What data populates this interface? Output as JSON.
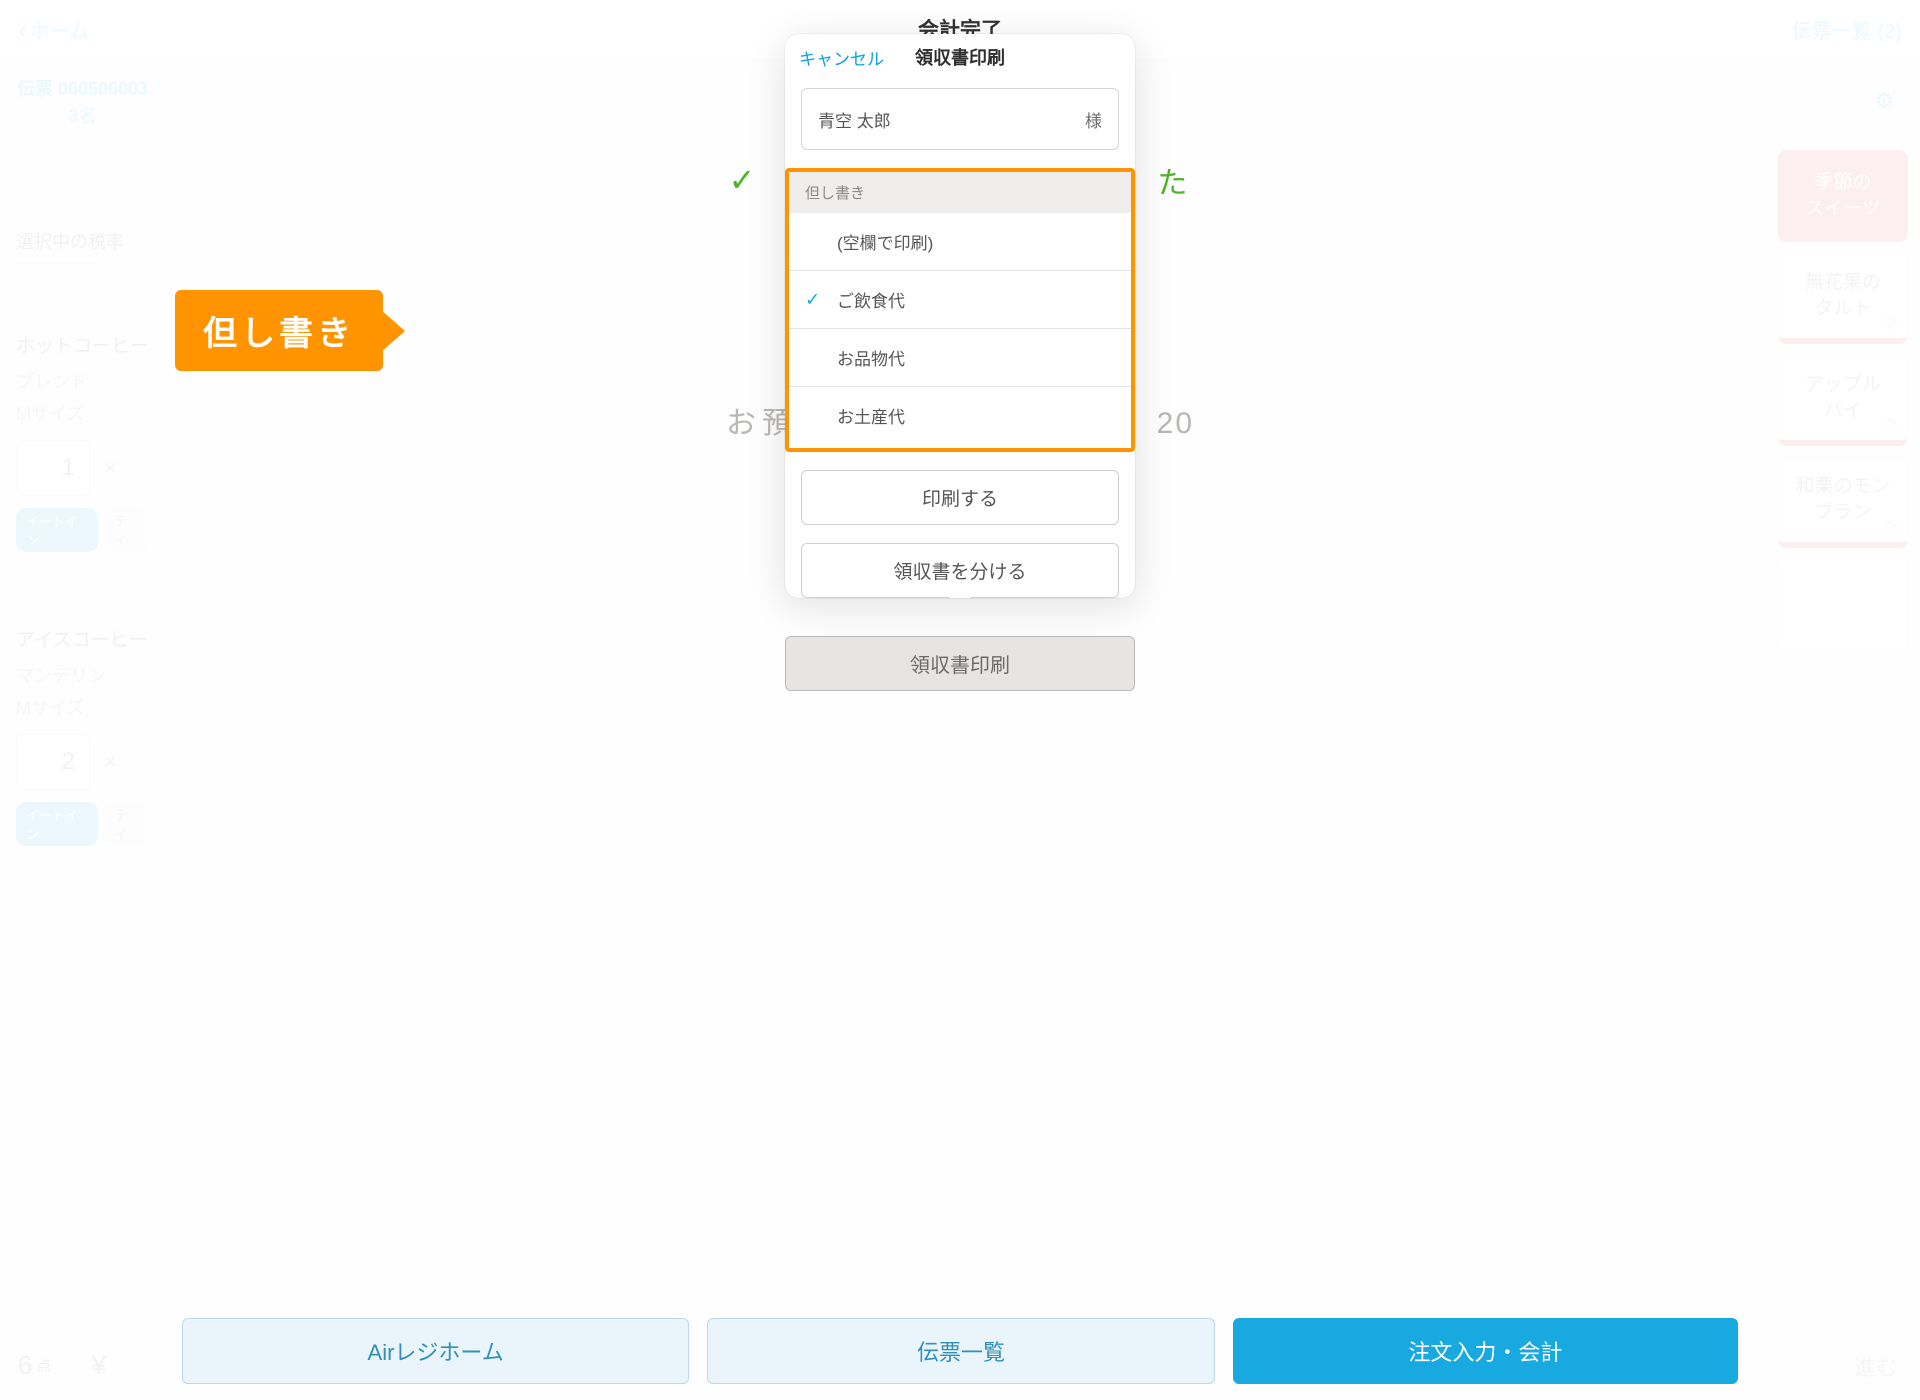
{
  "topbar": {
    "home": "ホーム",
    "ticket_list": "伝票一覧 (2)"
  },
  "ticket": {
    "label_number": "伝票 000500003",
    "guests": "3名"
  },
  "left": {
    "tax_label": "選択中の税率",
    "items": [
      {
        "title": "ホットコーヒー",
        "opt1": "ブレンド",
        "opt2": "Mサイズ",
        "qty": "1",
        "tag_eatin": "イートイン",
        "tag_take": "テイ"
      },
      {
        "title": "アイスコーヒー",
        "opt1": "マンデリン",
        "opt2": "Mサイズ",
        "qty": "2",
        "tag_eatin": "イートイン",
        "tag_take": "テイ"
      }
    ]
  },
  "tiles": [
    {
      "l1": "季節の",
      "l2": "スイーツ",
      "kind": "red"
    },
    {
      "l1": "無花果の",
      "l2": "タルト",
      "kind": "out"
    },
    {
      "l1": "アップル",
      "l2": "パイ",
      "kind": "out"
    },
    {
      "l1": "和栗のモン",
      "l2": "ブラン",
      "kind": "out"
    },
    {
      "l1": "",
      "l2": "",
      "kind": "plain"
    }
  ],
  "bottom": {
    "count": "6",
    "count_unit": "点",
    "yen": "¥",
    "proceed": "進む"
  },
  "modal": {
    "complete_title": "会計完了",
    "complete_check": "✓",
    "complete_msg_tail": "た",
    "deposit_head": "お預",
    "deposit_tail": "20",
    "receipt_print_ghost": "領収書印刷",
    "footer": {
      "home": "Airレジホーム",
      "list": "伝票一覧",
      "order": "注文入力・会計"
    }
  },
  "popover": {
    "cancel": "キャンセル",
    "title": "領収書印刷",
    "name_value": "青空 太郎",
    "name_suffix": "様",
    "proviso_header": "但し書き",
    "options": [
      {
        "label": "(空欄で印刷)",
        "checked": false
      },
      {
        "label": "ご飲食代",
        "checked": true
      },
      {
        "label": "お品物代",
        "checked": false
      },
      {
        "label": "お土産代",
        "checked": false
      }
    ],
    "btn_print": "印刷する",
    "btn_split": "領収書を分ける"
  },
  "callout": "但し書き"
}
